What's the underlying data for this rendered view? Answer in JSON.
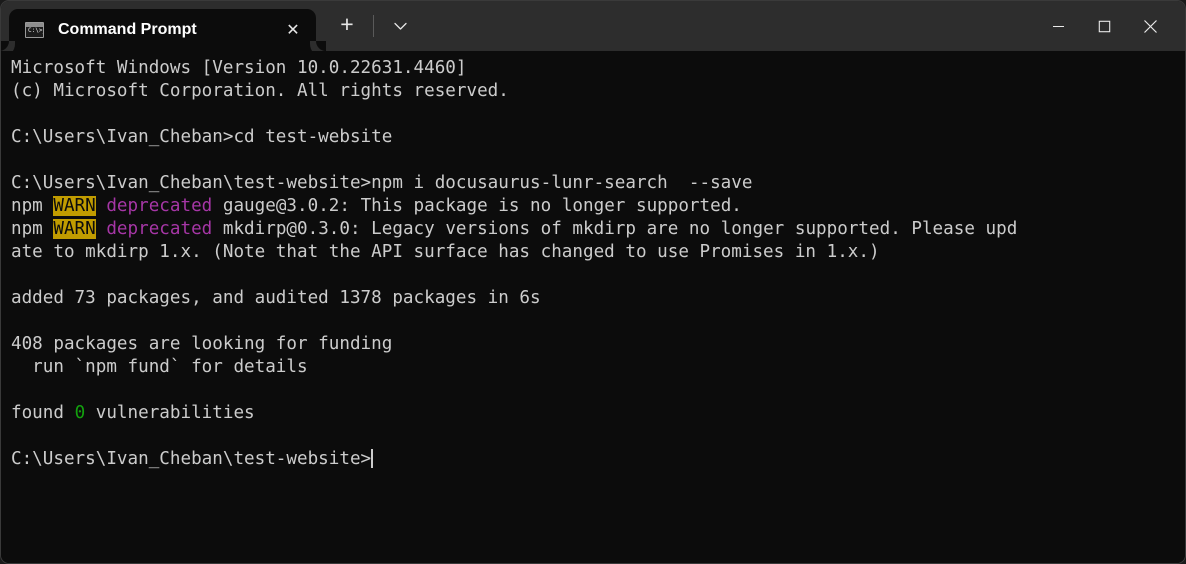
{
  "window": {
    "title": "Command Prompt",
    "controls": {
      "minimize": "minimize-button",
      "maximize": "maximize-button",
      "close": "close-button"
    },
    "colors": {
      "titlebar_bg": "#2d2d2d",
      "terminal_bg": "#0c0c0c",
      "text": "#cccccc",
      "warn_bg": "#c19c00",
      "warn_fg": "#0c0c0c",
      "deprecated": "#a636a6",
      "green": "#13a10e"
    }
  },
  "tab": {
    "label": "Command Prompt",
    "icon": "console-icon",
    "close_label": "✕",
    "glyph": "C:\\>_"
  },
  "tabbar": {
    "new_tab_label": "+",
    "dropdown_label": "⌄"
  },
  "terminal": {
    "lines": [
      {
        "segments": [
          {
            "text": "Microsoft Windows [Version 10.0.22631.4460]",
            "style": "default"
          }
        ]
      },
      {
        "segments": [
          {
            "text": "(c) Microsoft Corporation. All rights reserved.",
            "style": "default"
          }
        ]
      },
      {
        "segments": [
          {
            "text": "",
            "style": "default"
          }
        ]
      },
      {
        "segments": [
          {
            "text": "C:\\Users\\Ivan_Cheban>cd test-website",
            "style": "default"
          }
        ]
      },
      {
        "segments": [
          {
            "text": "",
            "style": "default"
          }
        ]
      },
      {
        "segments": [
          {
            "text": "C:\\Users\\Ivan_Cheban\\test-website>npm i docusaurus-lunr-search  --save",
            "style": "default"
          }
        ]
      },
      {
        "segments": [
          {
            "text": "npm ",
            "style": "default"
          },
          {
            "text": "WARN",
            "style": "warn"
          },
          {
            "text": " ",
            "style": "default"
          },
          {
            "text": "deprecated",
            "style": "magenta"
          },
          {
            "text": " gauge@3.0.2: This package is no longer supported.",
            "style": "default"
          }
        ]
      },
      {
        "segments": [
          {
            "text": "npm ",
            "style": "default"
          },
          {
            "text": "WARN",
            "style": "warn"
          },
          {
            "text": " ",
            "style": "default"
          },
          {
            "text": "deprecated",
            "style": "magenta"
          },
          {
            "text": " mkdirp@0.3.0: Legacy versions of mkdirp are no longer supported. Please upd",
            "style": "default"
          }
        ]
      },
      {
        "segments": [
          {
            "text": "ate to mkdirp 1.x. (Note that the API surface has changed to use Promises in 1.x.)",
            "style": "default"
          }
        ]
      },
      {
        "segments": [
          {
            "text": "",
            "style": "default"
          }
        ]
      },
      {
        "segments": [
          {
            "text": "added 73 packages, and audited 1378 packages in 6s",
            "style": "default"
          }
        ]
      },
      {
        "segments": [
          {
            "text": "",
            "style": "default"
          }
        ]
      },
      {
        "segments": [
          {
            "text": "408 packages are looking for funding",
            "style": "default"
          }
        ]
      },
      {
        "segments": [
          {
            "text": "  run `npm fund` for details",
            "style": "default"
          }
        ]
      },
      {
        "segments": [
          {
            "text": "",
            "style": "default"
          }
        ]
      },
      {
        "segments": [
          {
            "text": "found ",
            "style": "default"
          },
          {
            "text": "0",
            "style": "green"
          },
          {
            "text": " vulnerabilities",
            "style": "default"
          }
        ]
      },
      {
        "segments": [
          {
            "text": "",
            "style": "default"
          }
        ]
      },
      {
        "segments": [
          {
            "text": "C:\\Users\\Ivan_Cheban\\test-website>",
            "style": "default"
          },
          {
            "text": "",
            "style": "cursor"
          }
        ]
      }
    ]
  }
}
